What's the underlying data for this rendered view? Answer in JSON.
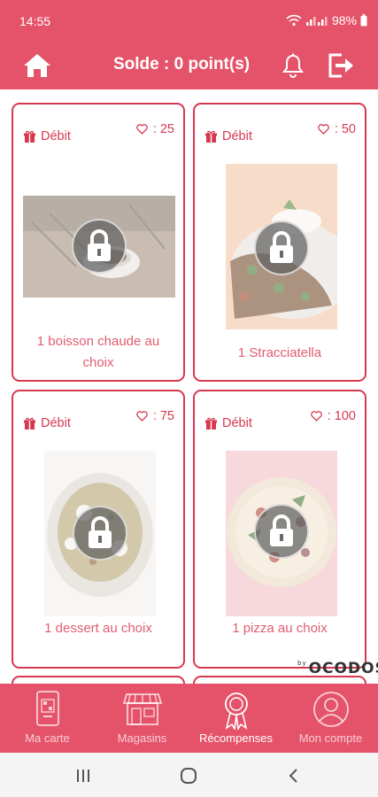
{
  "status_bar": {
    "time": "14:55",
    "battery": "98%"
  },
  "header": {
    "balance": "Solde : 0 point(s)"
  },
  "rewards": [
    {
      "type_label": "Débit",
      "likes": ": 25",
      "title": "1 boisson chaude au choix"
    },
    {
      "type_label": "Débit",
      "likes": ": 50",
      "title": "1 Stracciatella"
    },
    {
      "type_label": "Débit",
      "likes": ": 75",
      "title": "1 dessert au choix"
    },
    {
      "type_label": "Débit",
      "likes": ": 100",
      "title": "1 pizza au choix"
    }
  ],
  "brand": {
    "prefix": "by",
    "name": "OCODOS"
  },
  "bottom_nav": [
    {
      "label": "Ma carte",
      "icon": "phone-card-icon",
      "active": false
    },
    {
      "label": "Magasins",
      "icon": "store-icon",
      "active": false
    },
    {
      "label": "Récompenses",
      "icon": "award-ribbon-icon",
      "active": true
    },
    {
      "label": "Mon compte",
      "icon": "user-account-icon",
      "active": false
    }
  ],
  "colors": {
    "primary": "#e5536a",
    "card_border": "#d8384f",
    "text_accent": "#e05d71"
  }
}
